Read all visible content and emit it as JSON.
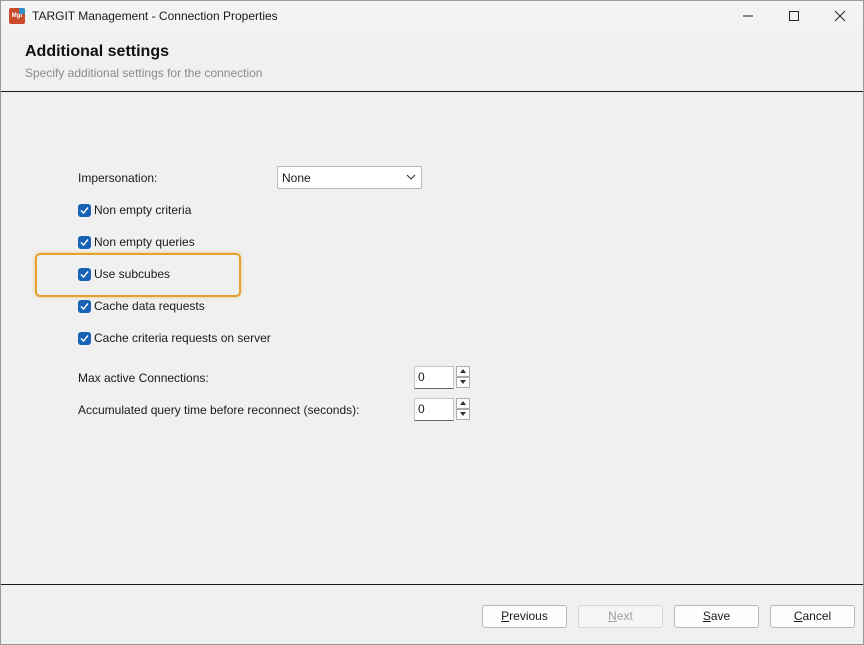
{
  "window": {
    "title": "TARGIT Management - Connection Properties",
    "icon_text": "Mgt"
  },
  "header": {
    "title": "Additional settings",
    "subtitle": "Specify additional settings for the connection"
  },
  "impersonation": {
    "label": "Impersonation:",
    "selected": "None"
  },
  "checkboxes": [
    {
      "label": "Non empty criteria",
      "checked": true
    },
    {
      "label": "Non empty queries",
      "checked": true
    },
    {
      "label": "Use subcubes",
      "checked": true
    },
    {
      "label": "Cache data requests",
      "checked": true
    },
    {
      "label": "Cache criteria requests on server",
      "checked": true
    }
  ],
  "max_connections": {
    "label": "Max active Connections:",
    "value": "0"
  },
  "accumulated_time": {
    "label": "Accumulated query time before reconnect (seconds):",
    "value": "0"
  },
  "buttons": {
    "previous": {
      "first": "P",
      "rest": "revious"
    },
    "next": {
      "first": "N",
      "rest": "ext"
    },
    "save": {
      "first": "S",
      "rest": "ave"
    },
    "cancel": {
      "first": "C",
      "rest": "ancel"
    }
  },
  "colors": {
    "accent": "#1a62b8",
    "highlight": "#e3a22a"
  }
}
